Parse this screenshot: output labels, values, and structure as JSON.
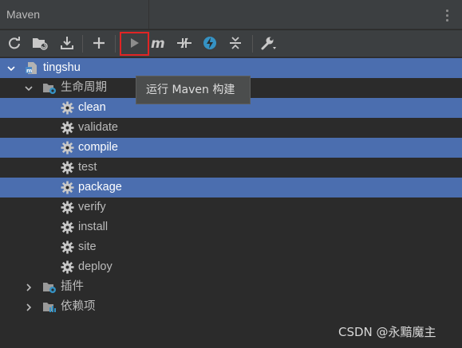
{
  "window": {
    "title": "Maven"
  },
  "toolbar": {
    "buttons": [
      {
        "name": "reload-icon"
      },
      {
        "name": "generate-sources-icon"
      },
      {
        "name": "download-icon"
      },
      {
        "name": "add-icon"
      },
      {
        "name": "run-icon",
        "highlighted": true
      },
      {
        "name": "execute-goal-icon"
      },
      {
        "name": "toggle-offline-icon"
      },
      {
        "name": "skip-tests-icon"
      },
      {
        "name": "collapse-all-icon"
      },
      {
        "name": "settings-wrench-icon"
      }
    ],
    "highlight_color": "#e02424"
  },
  "tree": {
    "project": "tingshu",
    "lifecycle": {
      "label": "生命周期",
      "goals": [
        {
          "label": "clean",
          "selected": true
        },
        {
          "label": "validate",
          "selected": false
        },
        {
          "label": "compile",
          "selected": true
        },
        {
          "label": "test",
          "selected": false
        },
        {
          "label": "package",
          "selected": true
        },
        {
          "label": "verify",
          "selected": false
        },
        {
          "label": "install",
          "selected": false
        },
        {
          "label": "site",
          "selected": false
        },
        {
          "label": "deploy",
          "selected": false
        }
      ]
    },
    "plugins": {
      "label": "插件"
    },
    "dependencies": {
      "label": "依赖项"
    }
  },
  "tooltip": {
    "text": "运行 Maven 构建"
  },
  "watermark": "CSDN @永黯魔主",
  "colors": {
    "selection": "#4b6eaf",
    "background": "#2b2b2b",
    "panel": "#3c3f41"
  }
}
